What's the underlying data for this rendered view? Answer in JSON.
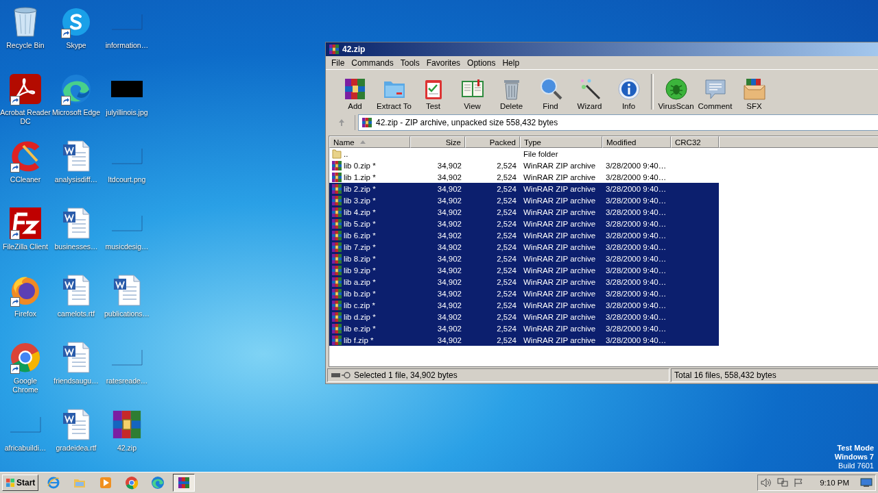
{
  "desktop": {
    "icons": [
      {
        "label": "Recycle Bin",
        "kind": "recycle",
        "shortcut": false
      },
      {
        "label": "Skype",
        "kind": "skype",
        "shortcut": true
      },
      {
        "label": "information…",
        "kind": "blank",
        "shortcut": false
      },
      {
        "label": "Acrobat Reader DC",
        "kind": "acrobat",
        "shortcut": true
      },
      {
        "label": "Microsoft Edge",
        "kind": "edge",
        "shortcut": true
      },
      {
        "label": "julyillinois.jpg",
        "kind": "dark",
        "shortcut": false
      },
      {
        "label": "CCleaner",
        "kind": "ccleaner",
        "shortcut": true
      },
      {
        "label": "analysisdiff…",
        "kind": "word",
        "shortcut": false
      },
      {
        "label": "ltdcourt.png",
        "kind": "blank",
        "shortcut": false
      },
      {
        "label": "FileZilla Client",
        "kind": "filezilla",
        "shortcut": true
      },
      {
        "label": "businesses…",
        "kind": "word",
        "shortcut": false
      },
      {
        "label": "musicdesig…",
        "kind": "blank",
        "shortcut": false
      },
      {
        "label": "Firefox",
        "kind": "firefox",
        "shortcut": true
      },
      {
        "label": "camelots.rtf",
        "kind": "word",
        "shortcut": false
      },
      {
        "label": "publications…",
        "kind": "word",
        "shortcut": false
      },
      {
        "label": "Google Chrome",
        "kind": "chrome",
        "shortcut": true
      },
      {
        "label": "friendsaugu…",
        "kind": "word",
        "shortcut": false
      },
      {
        "label": "ratesreade…",
        "kind": "blank",
        "shortcut": false
      },
      {
        "label": "africabuildi…",
        "kind": "blank",
        "shortcut": false
      },
      {
        "label": "gradeidea.rtf",
        "kind": "word",
        "shortcut": false
      },
      {
        "label": "42.zip",
        "kind": "winrar",
        "shortcut": false
      }
    ],
    "os_notice": [
      "Test Mode",
      "Windows 7",
      "Build 7601"
    ]
  },
  "window": {
    "title": "42.zip",
    "menu": [
      "File",
      "Commands",
      "Tools",
      "Favorites",
      "Options",
      "Help"
    ],
    "toolbar": [
      [
        {
          "label": "Add",
          "kind": "add"
        },
        {
          "label": "Extract To",
          "kind": "extract"
        },
        {
          "label": "Test",
          "kind": "test"
        },
        {
          "label": "View",
          "kind": "view"
        },
        {
          "label": "Delete",
          "kind": "delete"
        },
        {
          "label": "Find",
          "kind": "find"
        },
        {
          "label": "Wizard",
          "kind": "wizard"
        },
        {
          "label": "Info",
          "kind": "info"
        }
      ],
      [
        {
          "label": "VirusScan",
          "kind": "virus"
        },
        {
          "label": "Comment",
          "kind": "comment"
        },
        {
          "label": "SFX",
          "kind": "sfx"
        }
      ]
    ],
    "address": "42.zip - ZIP archive, unpacked size 558,432 bytes",
    "columns": [
      {
        "label": "Name",
        "sorted": true
      },
      {
        "label": "Size",
        "sorted": false
      },
      {
        "label": "Packed",
        "sorted": false
      },
      {
        "label": "Type",
        "sorted": false
      },
      {
        "label": "Modified",
        "sorted": false
      },
      {
        "label": "CRC32",
        "sorted": false
      }
    ],
    "rows": [
      {
        "kind": "folder",
        "name": "..",
        "size": "",
        "packed": "",
        "type": "File folder",
        "modified": "",
        "selected": false
      },
      {
        "kind": "archive",
        "name": "lib 0.zip *",
        "size": "34,902",
        "packed": "2,524",
        "type": "WinRAR ZIP archive",
        "modified": "3/28/2000 9:40…",
        "selected": false
      },
      {
        "kind": "archive",
        "name": "lib 1.zip *",
        "size": "34,902",
        "packed": "2,524",
        "type": "WinRAR ZIP archive",
        "modified": "3/28/2000 9:40…",
        "selected": false
      },
      {
        "kind": "archive",
        "name": "lib 2.zip *",
        "size": "34,902",
        "packed": "2,524",
        "type": "WinRAR ZIP archive",
        "modified": "3/28/2000 9:40…",
        "selected": true
      },
      {
        "kind": "archive",
        "name": "lib 3.zip *",
        "size": "34,902",
        "packed": "2,524",
        "type": "WinRAR ZIP archive",
        "modified": "3/28/2000 9:40…",
        "selected": true
      },
      {
        "kind": "archive",
        "name": "lib 4.zip *",
        "size": "34,902",
        "packed": "2,524",
        "type": "WinRAR ZIP archive",
        "modified": "3/28/2000 9:40…",
        "selected": true
      },
      {
        "kind": "archive",
        "name": "lib 5.zip *",
        "size": "34,902",
        "packed": "2,524",
        "type": "WinRAR ZIP archive",
        "modified": "3/28/2000 9:40…",
        "selected": true
      },
      {
        "kind": "archive",
        "name": "lib 6.zip *",
        "size": "34,902",
        "packed": "2,524",
        "type": "WinRAR ZIP archive",
        "modified": "3/28/2000 9:40…",
        "selected": true
      },
      {
        "kind": "archive",
        "name": "lib 7.zip *",
        "size": "34,902",
        "packed": "2,524",
        "type": "WinRAR ZIP archive",
        "modified": "3/28/2000 9:40…",
        "selected": true
      },
      {
        "kind": "archive",
        "name": "lib 8.zip *",
        "size": "34,902",
        "packed": "2,524",
        "type": "WinRAR ZIP archive",
        "modified": "3/28/2000 9:40…",
        "selected": true
      },
      {
        "kind": "archive",
        "name": "lib 9.zip *",
        "size": "34,902",
        "packed": "2,524",
        "type": "WinRAR ZIP archive",
        "modified": "3/28/2000 9:40…",
        "selected": true
      },
      {
        "kind": "archive",
        "name": "lib a.zip *",
        "size": "34,902",
        "packed": "2,524",
        "type": "WinRAR ZIP archive",
        "modified": "3/28/2000 9:40…",
        "selected": true
      },
      {
        "kind": "archive",
        "name": "lib b.zip *",
        "size": "34,902",
        "packed": "2,524",
        "type": "WinRAR ZIP archive",
        "modified": "3/28/2000 9:40…",
        "selected": true
      },
      {
        "kind": "archive",
        "name": "lib c.zip *",
        "size": "34,902",
        "packed": "2,524",
        "type": "WinRAR ZIP archive",
        "modified": "3/28/2000 9:40…",
        "selected": true
      },
      {
        "kind": "archive",
        "name": "lib d.zip *",
        "size": "34,902",
        "packed": "2,524",
        "type": "WinRAR ZIP archive",
        "modified": "3/28/2000 9:40…",
        "selected": true
      },
      {
        "kind": "archive",
        "name": "lib e.zip *",
        "size": "34,902",
        "packed": "2,524",
        "type": "WinRAR ZIP archive",
        "modified": "3/28/2000 9:40…",
        "selected": true
      },
      {
        "kind": "archive",
        "name": "lib f.zip *",
        "size": "34,902",
        "packed": "2,524",
        "type": "WinRAR ZIP archive",
        "modified": "3/28/2000 9:40…",
        "selected": true
      }
    ],
    "status": {
      "selection": "Selected 1 file, 34,902 bytes",
      "total": "Total 16 files, 558,432 bytes"
    }
  },
  "taskbar": {
    "start": "Start",
    "apps": [
      {
        "kind": "ie",
        "active": false
      },
      {
        "kind": "explorer",
        "active": false
      },
      {
        "kind": "media",
        "active": false
      },
      {
        "kind": "chrome",
        "active": false
      },
      {
        "kind": "edge",
        "active": false
      },
      {
        "kind": "winrar",
        "active": true
      }
    ],
    "time": "9:10 PM"
  }
}
